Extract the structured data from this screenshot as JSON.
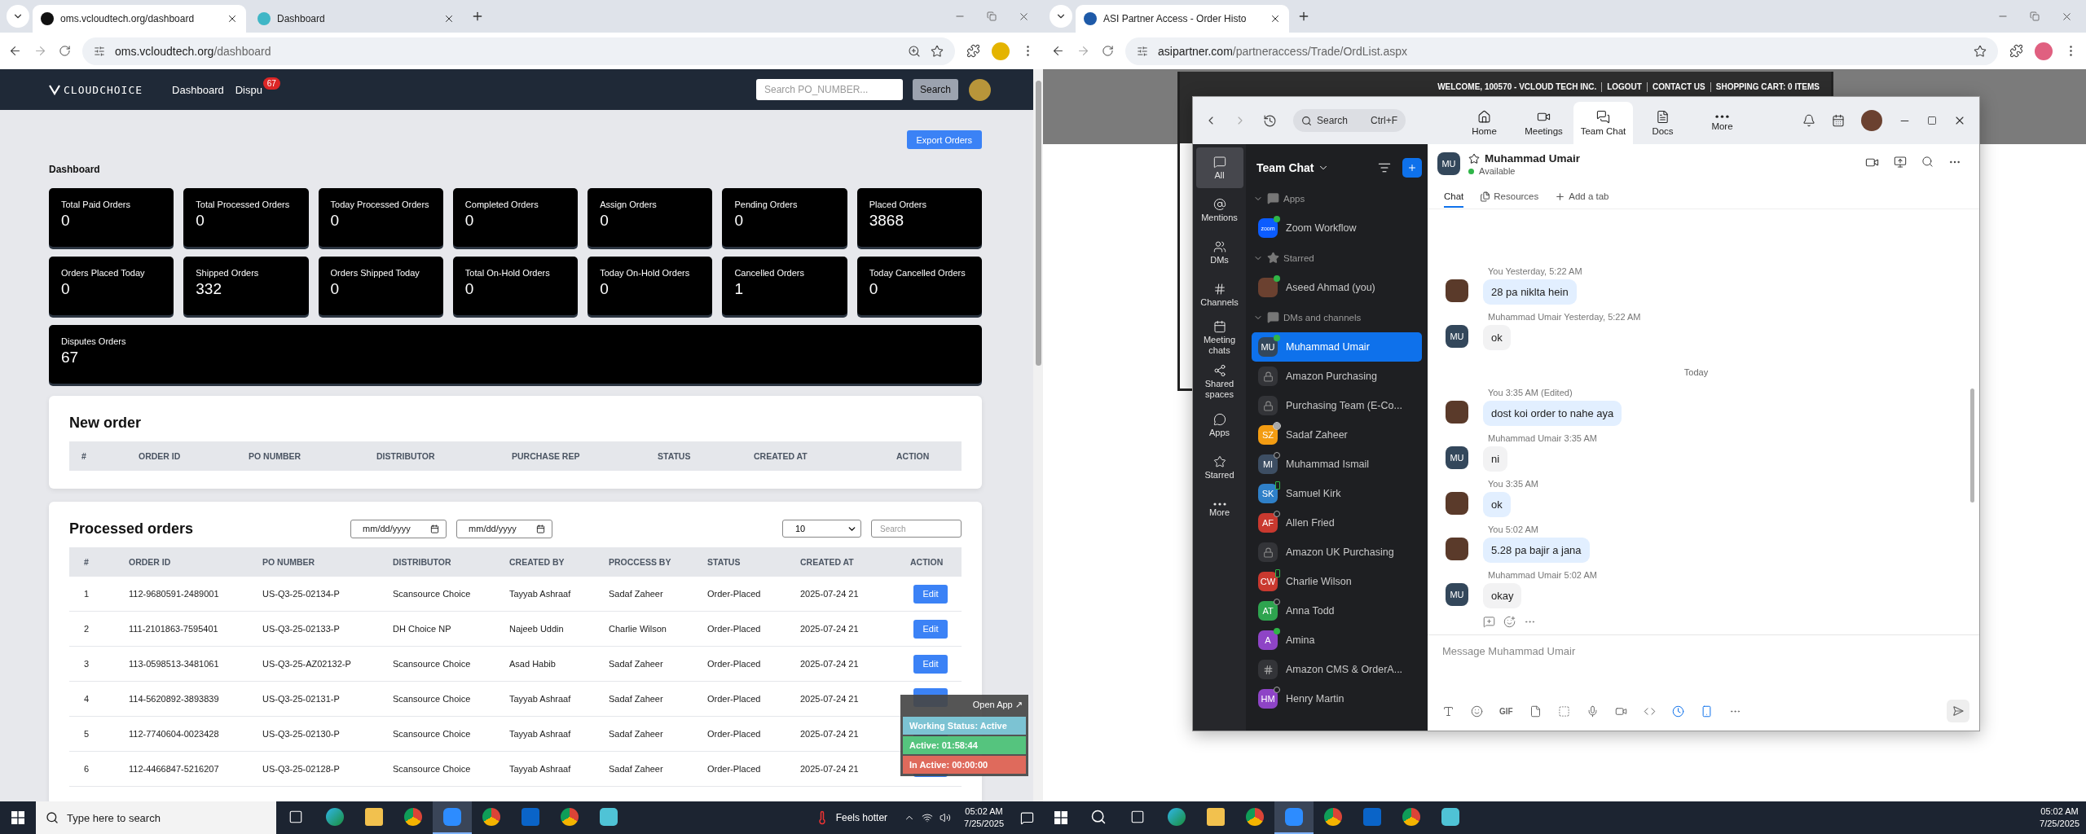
{
  "left_browser": {
    "tabs": [
      {
        "title": "oms.vcloudtech.org/dashboard",
        "selected": true
      },
      {
        "title": "Dashboard",
        "selected": false
      }
    ],
    "url_host": "oms.vcloudtech.org",
    "url_path": "/dashboard"
  },
  "dashboard": {
    "brand": "CLOUDCHOICE",
    "nav": [
      {
        "label": "Dashboard"
      },
      {
        "label": "Dispu",
        "badge": "67"
      }
    ],
    "search_placeholder": "Search PO_NUMBER...",
    "search_button": "Search",
    "export_button": "Export Orders",
    "heading": "Dashboard",
    "cards": [
      {
        "label": "Total Paid Orders",
        "value": "0"
      },
      {
        "label": "Total Processed Orders",
        "value": "0"
      },
      {
        "label": "Today Processed Orders",
        "value": "0"
      },
      {
        "label": "Completed Orders",
        "value": "0"
      },
      {
        "label": "Assign Orders",
        "value": "0"
      },
      {
        "label": "Pending Orders",
        "value": "0"
      },
      {
        "label": "Placed Orders",
        "value": "3868"
      },
      {
        "label": "Orders Placed Today",
        "value": "0"
      },
      {
        "label": "Shipped Orders",
        "value": "332"
      },
      {
        "label": "Orders Shipped Today",
        "value": "0"
      },
      {
        "label": "Total On-Hold Orders",
        "value": "0"
      },
      {
        "label": "Today On-Hold Orders",
        "value": "0"
      },
      {
        "label": "Cancelled Orders",
        "value": "1"
      },
      {
        "label": "Today Cancelled Orders",
        "value": "0"
      }
    ],
    "wide_card": {
      "label": "Disputes Orders",
      "value": "67"
    },
    "new_order": {
      "title": "New order",
      "columns": [
        "#",
        "ORDER ID",
        "PO NUMBER",
        "DISTRIBUTOR",
        "PURCHASE REP",
        "STATUS",
        "CREATED AT",
        "ACTION"
      ]
    },
    "processed": {
      "title": "Processed orders",
      "date_fields": [
        "mm/dd/yyyy",
        "mm/dd/yyyy"
      ],
      "page_size": "10",
      "search_placeholder": "Search",
      "columns": [
        "#",
        "ORDER ID",
        "PO NUMBER",
        "DISTRIBUTOR",
        "CREATED BY",
        "PROCCESS BY",
        "STATUS",
        "CREATED AT",
        "ACTION"
      ],
      "rows": [
        [
          "1",
          "112-9680591-2489001",
          "US-Q3-25-02134-P",
          "Scansource Choice",
          "Tayyab Ashraaf",
          "Sadaf Zaheer",
          "Order-Placed",
          "2025-07-24 21",
          "Edit"
        ],
        [
          "2",
          "111-2101863-7595401",
          "US-Q3-25-02133-P",
          "DH Choice NP",
          "Najeeb Uddin",
          "Charlie Wilson",
          "Order-Placed",
          "2025-07-24 21",
          "Edit"
        ],
        [
          "3",
          "113-0598513-3481061",
          "US-Q3-25-AZ02132-P",
          "Scansource Choice",
          "Asad Habib",
          "Sadaf Zaheer",
          "Order-Placed",
          "2025-07-24 21",
          "Edit"
        ],
        [
          "4",
          "114-5620892-3893839",
          "US-Q3-25-02131-P",
          "Scansource Choice",
          "Tayyab Ashraaf",
          "Sadaf Zaheer",
          "Order-Placed",
          "2025-07-24 21"
        ],
        [
          "5",
          "112-7740604-0023428",
          "US-Q3-25-02130-P",
          "Scansource Choice",
          "Tayyab Ashraaf",
          "Sadaf Zaheer",
          "Order-Placed",
          "2025-07-24 21"
        ],
        [
          "6",
          "112-4466847-5216207",
          "US-Q3-25-02128-P",
          "Scansource Choice",
          "Tayyab Ashraaf",
          "Sadaf Zaheer",
          "Order-Placed",
          "2025-07-24 21"
        ]
      ]
    }
  },
  "tracker": {
    "open_app": "Open App ↗",
    "status": "Working Status: Active",
    "active": "Active: 01:58:44",
    "inactive": "In Active: 00:00:00"
  },
  "right_browser": {
    "tabs": [
      {
        "title": "ASI Partner Access - Order Histo",
        "selected": true
      }
    ],
    "url_host": "asipartner.com",
    "url_path": "/partneraccess/Trade/OrdList.aspx",
    "header_links": [
      "WELCOME, 100570 - VCLOUD TECH INC.",
      "LOGOUT",
      "CONTACT US",
      "SHOPPING CART: 0 ITEMS"
    ]
  },
  "zoom": {
    "search": "Search",
    "shortcut": "Ctrl+F",
    "nav": [
      {
        "label": "Home",
        "kind": "home",
        "selected": false
      },
      {
        "label": "Meetings",
        "kind": "meetings",
        "selected": false
      },
      {
        "label": "Team Chat",
        "kind": "chat",
        "selected": true
      },
      {
        "label": "Docs",
        "kind": "docs",
        "selected": false
      },
      {
        "label": "More",
        "kind": "more",
        "selected": false
      }
    ],
    "rail": [
      {
        "label": "All",
        "kind": "all",
        "selected": true
      },
      {
        "label": "Mentions",
        "kind": "mentions",
        "selected": false
      },
      {
        "label": "DMs",
        "kind": "dms",
        "selected": false
      },
      {
        "label": "Channels",
        "kind": "channels",
        "selected": false
      },
      {
        "label": "Meeting chats",
        "kind": "meeting",
        "selected": false
      },
      {
        "label": "Shared spaces",
        "kind": "shared",
        "selected": false
      },
      {
        "label": "Apps",
        "kind": "apps",
        "selected": false
      },
      {
        "label": "Starred",
        "kind": "starred",
        "selected": false
      },
      {
        "label": "More",
        "kind": "more",
        "selected": false
      }
    ],
    "list_title": "Team Chat",
    "sections": [
      {
        "label": "Apps",
        "kind": "apps",
        "expanded": true,
        "children": [
          {
            "name": "Zoom Workflow",
            "kind": "app",
            "icon_text": "zoom",
            "online": true,
            "away": false,
            "mobile": false,
            "selected": false
          }
        ]
      },
      {
        "label": "Starred",
        "kind": "starred",
        "expanded": true,
        "children": [
          {
            "name": "Aseed Ahmad (you)",
            "kind": "self",
            "online": true,
            "away": false,
            "mobile": false,
            "selected": false
          }
        ]
      },
      {
        "label": "DMs and channels",
        "kind": "dms",
        "expanded": true,
        "children": [
          {
            "name": "Muhammad Umair",
            "kind": "person",
            "initials": "MU",
            "color": "#33475b",
            "online": true,
            "away": false,
            "mobile": false,
            "selected": true
          },
          {
            "name": "Amazon Purchasing",
            "kind": "private_channel",
            "selected": false
          },
          {
            "name": "Purchasing Team (E-Co...",
            "kind": "private_channel",
            "selected": false
          },
          {
            "name": "Sadaf Zaheer",
            "kind": "person",
            "initials": "SZ",
            "color": "#f39c12",
            "online": false,
            "away": true,
            "mobile": false,
            "selected": false
          },
          {
            "name": "Muhammad Ismail",
            "kind": "person",
            "initials": "MI",
            "color": "#3d4e63",
            "online": false,
            "away": false,
            "mobile": false,
            "selected": false
          },
          {
            "name": "Samuel Kirk",
            "kind": "person",
            "initials": "SK",
            "color": "#2f80c8",
            "online": true,
            "away": false,
            "mobile": true,
            "selected": false
          },
          {
            "name": "Allen Fried",
            "kind": "person",
            "initials": "AF",
            "color": "#c9392f",
            "online": false,
            "away": false,
            "mobile": false,
            "selected": false
          },
          {
            "name": "Amazon UK Purchasing",
            "kind": "private_channel",
            "selected": false
          },
          {
            "name": "Charlie Wilson",
            "kind": "person",
            "initials": "CW",
            "color": "#c9392f",
            "online": true,
            "away": false,
            "mobile": true,
            "selected": false
          },
          {
            "name": "Anna Todd",
            "kind": "person",
            "initials": "AT",
            "color": "#2ea44f",
            "online": false,
            "away": false,
            "mobile": false,
            "selected": false
          },
          {
            "name": "Amina",
            "kind": "person",
            "initials": "A",
            "color": "#8e44c6",
            "online": true,
            "away": false,
            "mobile": false,
            "selected": false
          },
          {
            "name": "Amazon CMS & OrderA...",
            "kind": "channel",
            "selected": false
          },
          {
            "name": "Henry Martin",
            "kind": "person",
            "initials": "HM",
            "color": "#8e44c6",
            "online": false,
            "away": false,
            "mobile": false,
            "selected": false
          }
        ]
      }
    ],
    "chat": {
      "name": "Muhammad Umair",
      "initials": "MU",
      "presence": "Available",
      "tabs": [
        {
          "label": "Chat",
          "kind": "chat",
          "selected": true
        },
        {
          "label": "Resources",
          "kind": "resources",
          "selected": false
        },
        {
          "label": "Add a tab",
          "kind": "add",
          "selected": false
        }
      ],
      "messages": [
        {
          "kind": "message",
          "mine": true,
          "sender": "You",
          "time": "Yesterday, 5:22 AM",
          "text": "28 pa niklta hein"
        },
        {
          "kind": "message",
          "mine": false,
          "initials": "MU",
          "sender": "Muhammad Umair",
          "time": "Yesterday, 5:22 AM",
          "text": "ok"
        },
        {
          "kind": "divider",
          "text": "Today"
        },
        {
          "kind": "message",
          "mine": true,
          "sender": "You",
          "time": "3:35 AM (Edited)",
          "text": "dost koi order to nahe aya"
        },
        {
          "kind": "message",
          "mine": false,
          "initials": "MU",
          "sender": "Muhammad Umair",
          "time": "3:35 AM",
          "text": "ni"
        },
        {
          "kind": "message",
          "mine": true,
          "sender": "You",
          "time": "3:35 AM",
          "text": "ok"
        },
        {
          "kind": "message",
          "mine": true,
          "sender": "You",
          "time": "5:02 AM",
          "text": "5.28 pa bajir a jana"
        },
        {
          "kind": "message",
          "mine": false,
          "initials": "MU",
          "sender": "Muhammad Umair",
          "time": "5:02 AM",
          "text": "okay"
        }
      ],
      "composer_placeholder": "Message Muhammad Umair",
      "gif": "GIF"
    }
  },
  "taskbar_left": {
    "search": "Type here to search",
    "weather": "Feels hotter",
    "time": "05:02 AM",
    "date": "7/25/2025",
    "apps": [
      {
        "kind": "taskview",
        "active": false
      },
      {
        "kind": "edge",
        "active": false
      },
      {
        "kind": "explorer",
        "active": false
      },
      {
        "kind": "chrome",
        "active": false
      },
      {
        "kind": "zoom",
        "active": true
      },
      {
        "kind": "chrome",
        "active": false
      },
      {
        "kind": "outlook",
        "active": false
      },
      {
        "kind": "chrome",
        "active": false
      },
      {
        "kind": "app",
        "active": false
      }
    ]
  },
  "taskbar_right": {
    "time": "05:02 AM",
    "date": "7/25/2025",
    "apps": [
      {
        "kind": "search",
        "active": false
      },
      {
        "kind": "taskview",
        "active": false
      },
      {
        "kind": "edge",
        "active": false
      },
      {
        "kind": "explorer",
        "active": false
      },
      {
        "kind": "chrome",
        "active": false
      },
      {
        "kind": "zoom",
        "active": true
      },
      {
        "kind": "chrome",
        "active": false
      },
      {
        "kind": "outlook",
        "active": false
      },
      {
        "kind": "chrome",
        "active": false
      },
      {
        "kind": "app",
        "active": false
      }
    ]
  }
}
